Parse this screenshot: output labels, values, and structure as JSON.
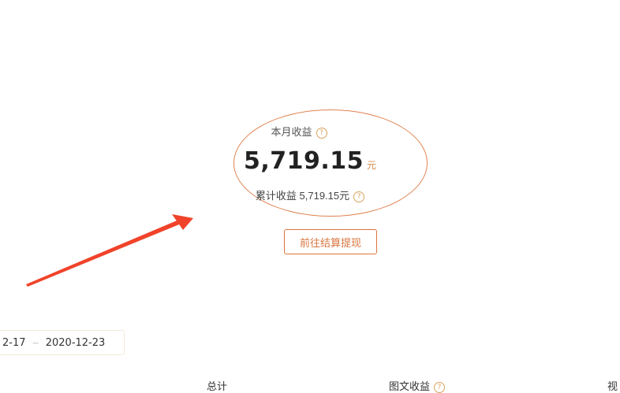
{
  "earnings": {
    "month_label": "本月收益",
    "month_help_icon": "question-circle-icon",
    "amount": "5,719.15",
    "unit": "元",
    "total_label": "累计收益",
    "total_amount": "5,719.15元",
    "total_help_icon": "question-circle-icon"
  },
  "withdraw_button": {
    "label": "前往结算提现"
  },
  "date_range": {
    "start": "2-17",
    "separator": "~",
    "end": "2020-12-23"
  },
  "table": {
    "headers": [
      "总计",
      "图文收益",
      "视"
    ]
  },
  "colors": {
    "accent": "#d9743f",
    "ellipse": "#e0824f",
    "arrow": "#f0432a"
  }
}
